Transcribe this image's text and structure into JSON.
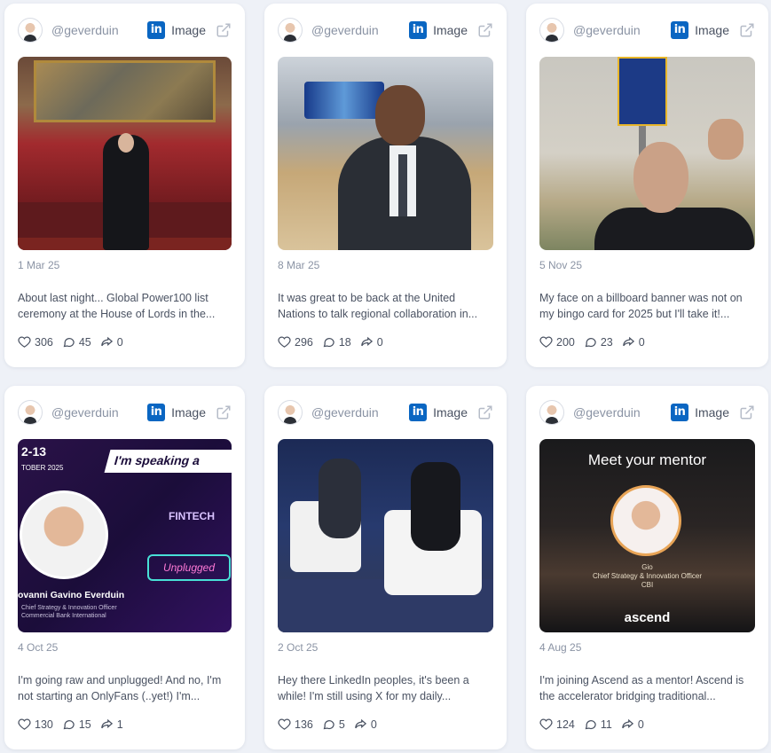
{
  "cards": [
    {
      "handle": "@geverduin",
      "kind": "Image",
      "date": "1 Mar 25",
      "text": "About last night... Global Power100 list ceremony at the House of Lords in the...",
      "likes": "306",
      "comments": "45",
      "shares": "0"
    },
    {
      "handle": "@geverduin",
      "kind": "Image",
      "date": "8 Mar 25",
      "text": "It was great to be back at the United Nations to talk regional collaboration in...",
      "likes": "296",
      "comments": "18",
      "shares": "0"
    },
    {
      "handle": "@geverduin",
      "kind": "Image",
      "date": "5 Nov 25",
      "text": "My face on a billboard banner was not on my bingo card for 2025 but I'll take it!...",
      "likes": "200",
      "comments": "23",
      "shares": "0"
    },
    {
      "handle": "@geverduin",
      "kind": "Image",
      "date": "4 Oct 25",
      "text": "I'm going raw and unplugged! And no, I'm not starting an OnlyFans (..yet!) I'm...",
      "likes": "130",
      "comments": "15",
      "shares": "1",
      "image_text": {
        "dates": "2-13",
        "month": "TOBER 2025",
        "speaking": "I'm speaking a",
        "fintech": "FINTECH",
        "unplugged": "Unplugged",
        "name": "ovanni Gavino Everduin",
        "role": "Chief Strategy & Innovation Officer",
        "org": "Commercial Bank International"
      }
    },
    {
      "handle": "@geverduin",
      "kind": "Image",
      "date": "2 Oct 25",
      "text": "Hey there LinkedIn peoples, it's been a while! I'm still using X for my daily...",
      "likes": "136",
      "comments": "5",
      "shares": "0"
    },
    {
      "handle": "@geverduin",
      "kind": "Image",
      "date": "4 Aug 25",
      "text": "I'm joining Ascend as a mentor! Ascend is the accelerator bridging traditional...",
      "likes": "124",
      "comments": "11",
      "shares": "0",
      "image_text": {
        "title": "Meet your mentor",
        "name": "Gio",
        "role": "Chief Strategy & Innovation Officer",
        "org": "CBI",
        "brand": "ascend"
      }
    }
  ],
  "icons": {
    "network": "linkedin-icon",
    "open": "external-link-icon",
    "like": "heart-icon",
    "comment": "comment-icon",
    "share": "share-icon"
  },
  "colors": {
    "linkedin": "#0a66c2",
    "background": "#eef1f7",
    "card": "#ffffff"
  }
}
